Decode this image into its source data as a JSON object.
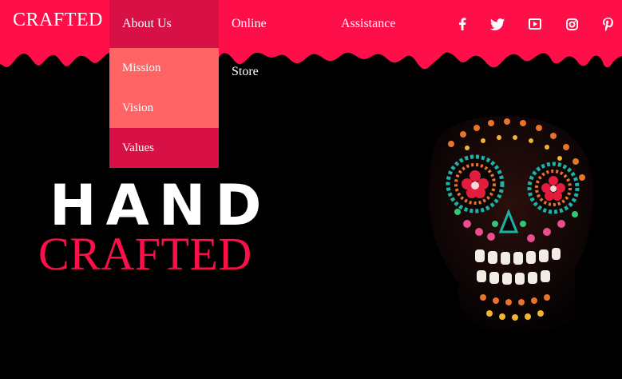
{
  "brand": {
    "logo": "CRAFTED",
    "accent": "#ff0f4a",
    "menu_active": "#d71146",
    "menu_item": "#ff6364"
  },
  "nav": {
    "items": [
      "About Us",
      "Online Store",
      "Assistance"
    ]
  },
  "dropdown": {
    "items": [
      "Mission",
      "Vision",
      "Values"
    ]
  },
  "social": [
    "facebook-icon",
    "twitter-icon",
    "youtube-icon",
    "instagram-icon",
    "pinterest-icon"
  ],
  "hero": {
    "line1": "HAND",
    "line2": "CRAFTED"
  }
}
